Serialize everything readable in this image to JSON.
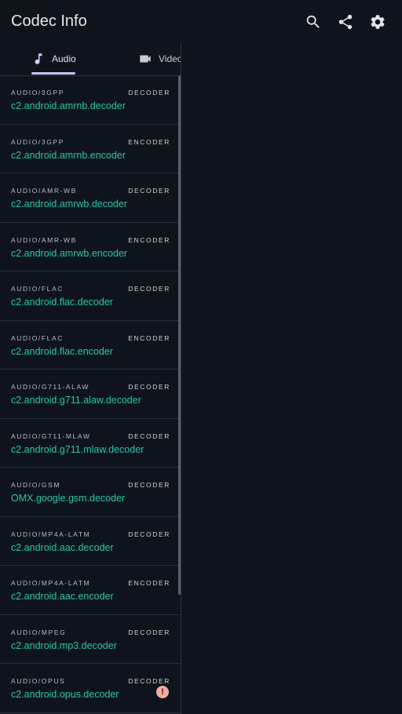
{
  "app": {
    "title": "Codec Info"
  },
  "actions": [
    {
      "name": "search-icon"
    },
    {
      "name": "share-icon"
    },
    {
      "name": "settings-icon"
    }
  ],
  "tabs": [
    {
      "label": "Audio",
      "icon": "music-note-icon",
      "selected": true
    },
    {
      "label": "Video",
      "icon": "videocam-icon",
      "selected": false
    }
  ],
  "codecs": [
    {
      "mime": "AUDIO/3GPP",
      "kind": "DECODER",
      "name": "c2.android.amrnb.decoder"
    },
    {
      "mime": "AUDIO/3GPP",
      "kind": "ENCODER",
      "name": "c2.android.amrnb.encoder"
    },
    {
      "mime": "AUDIO/AMR-WB",
      "kind": "DECODER",
      "name": "c2.android.amrwb.decoder"
    },
    {
      "mime": "AUDIO/AMR-WB",
      "kind": "ENCODER",
      "name": "c2.android.amrwb.encoder"
    },
    {
      "mime": "AUDIO/FLAC",
      "kind": "DECODER",
      "name": "c2.android.flac.decoder"
    },
    {
      "mime": "AUDIO/FLAC",
      "kind": "ENCODER",
      "name": "c2.android.flac.encoder"
    },
    {
      "mime": "AUDIO/G711-ALAW",
      "kind": "DECODER",
      "name": "c2.android.g711.alaw.decoder"
    },
    {
      "mime": "AUDIO/G711-MLAW",
      "kind": "DECODER",
      "name": "c2.android.g711.mlaw.decoder"
    },
    {
      "mime": "AUDIO/GSM",
      "kind": "DECODER",
      "name": "OMX.google.gsm.decoder"
    },
    {
      "mime": "AUDIO/MP4A-LATM",
      "kind": "DECODER",
      "name": "c2.android.aac.decoder"
    },
    {
      "mime": "AUDIO/MP4A-LATM",
      "kind": "ENCODER",
      "name": "c2.android.aac.encoder"
    },
    {
      "mime": "AUDIO/MPEG",
      "kind": "DECODER",
      "name": "c2.android.mp3.decoder"
    },
    {
      "mime": "AUDIO/OPUS",
      "kind": "DECODER",
      "name": "c2.android.opus.decoder",
      "warning": "!"
    }
  ],
  "colors": {
    "background": "#0f141c",
    "accent": "#2ec4a9",
    "tab_indicator": "#cfc3f5",
    "warning": "#f4a9a5"
  }
}
